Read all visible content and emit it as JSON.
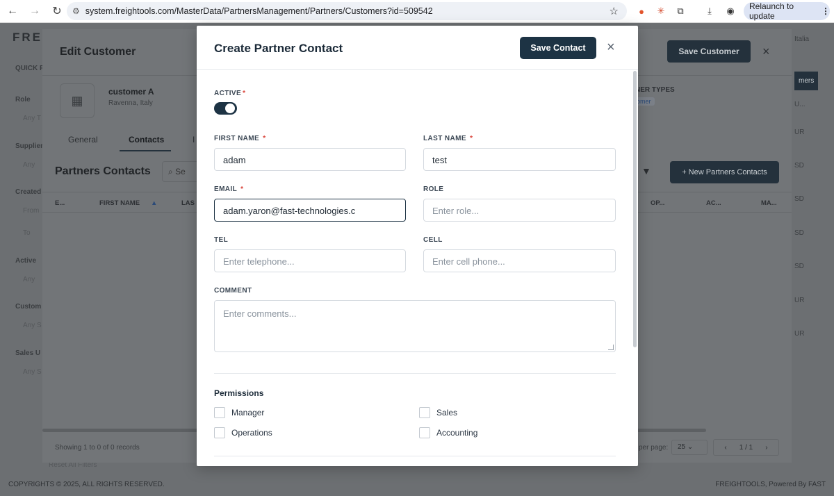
{
  "browser": {
    "url": "system.freightools.com/MasterData/PartnersManagement/Partners/Customers?id=509542",
    "relaunch_label": "Relaunch to update"
  },
  "app": {
    "logo": "FRE",
    "sidebar": [
      {
        "label": "QUICK F",
        "sub": ""
      },
      {
        "label": "Role",
        "sub": "Any T"
      },
      {
        "label": "Supplier",
        "sub": "Any"
      },
      {
        "label": "Created",
        "sub": "From"
      },
      {
        "label": "",
        "sub": "To"
      },
      {
        "label": "Active",
        "sub": "Any"
      },
      {
        "label": "Custom",
        "sub": "Any S"
      },
      {
        "label": "Sales U",
        "sub": "Any S"
      }
    ],
    "right_col": [
      "Italia",
      "mers",
      "U...",
      "UR",
      "SD",
      "SD",
      "SD",
      "SD",
      "UR",
      "UR"
    ],
    "footer_left": "COPYRIGHTS © 2025, ALL RIGHTS RESERVED.",
    "footer_right": "FREIGHTOOLS, Powered By FAST",
    "reset_filters": "Reset All Filters"
  },
  "edit_customer": {
    "title": "Edit Customer",
    "save_label": "Save Customer",
    "close_icon": "×",
    "customer_name": "customer A",
    "customer_location": "Ravenna, Italy",
    "partner_types_label": "NER TYPES",
    "partner_type_badge": "omer",
    "tabs": [
      "General",
      "Contacts",
      "I"
    ],
    "contacts_title": "Partners Contacts",
    "search_placeholder": "Se",
    "new_contacts_label": "+ New Partners Contacts",
    "columns": [
      "E...",
      "FIRST NAME",
      "LAS",
      "OP...",
      "AC...",
      "MA..."
    ],
    "showing": "Showing 1 to 0 of 0 records",
    "per_page_label": "per page:",
    "per_page_value": "25",
    "pager": "1 / 1"
  },
  "modal": {
    "title": "Create Partner Contact",
    "save_label": "Save Contact",
    "close_icon": "×",
    "active_label": "ACTIVE",
    "active_on": true,
    "first_name": {
      "label": "FIRST NAME",
      "value": "adam"
    },
    "last_name": {
      "label": "LAST NAME",
      "value": "test"
    },
    "email": {
      "label": "EMAIL",
      "value": "adam.yaron@fast-technologies.c"
    },
    "role": {
      "label": "ROLE",
      "placeholder": "Enter role..."
    },
    "tel": {
      "label": "TEL",
      "placeholder": "Enter telephone..."
    },
    "cell": {
      "label": "CELL",
      "placeholder": "Enter cell phone..."
    },
    "comment": {
      "label": "COMMENT",
      "placeholder": "Enter comments..."
    },
    "required_mark": "*",
    "permissions_title": "Permissions",
    "permissions": [
      "Manager",
      "Sales",
      "Operations",
      "Accounting"
    ]
  }
}
